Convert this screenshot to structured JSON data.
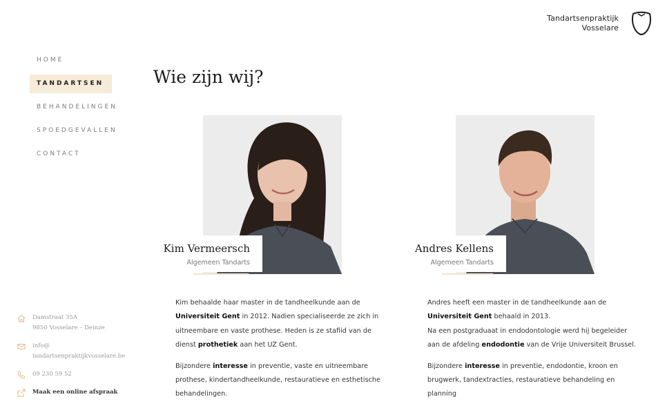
{
  "brand": {
    "line1": "Tandartsenpraktijk",
    "line2": "Vosselare",
    "logo": "tooth-icon"
  },
  "nav": {
    "items": [
      {
        "label": "HOME",
        "active": false
      },
      {
        "label": "TANDARTSEN",
        "active": true
      },
      {
        "label": "BEHANDELINGEN",
        "active": false
      },
      {
        "label": "SPOEDGEVALLEN",
        "active": false
      },
      {
        "label": "CONTACT",
        "active": false
      }
    ]
  },
  "contact": {
    "address_line1": "Damstraat 35A",
    "address_line2": "9850 Vosselare – Deinze",
    "email_line1": "info@",
    "email_line2": "tandartsenpraktijkvosselare.be",
    "phone": "09 230 59 52",
    "appointment": "Maak een online afspraak"
  },
  "page": {
    "title": "Wie zijn wij?"
  },
  "dentists": [
    {
      "name": "Kim Vermeersch",
      "role": "Algemeen Tandarts",
      "bio1": {
        "a": "Kim behaalde haar master in de tandheelkunde aan de ",
        "b1": "Universiteit Gent",
        "c": " in 2012. Nadien specialiseerde ze zich in uitneembare en vaste prothese. Heden is ze stafiid van de dienst ",
        "b2": "prothetiek",
        "d": " aan het UZ Gent."
      },
      "bio2": {
        "a": "Bijzondere ",
        "b": "interesse",
        "c": " in preventie, vaste en uitneembare prothese, kindertandheelkunde, restauratieve en esthetische behandelingen."
      }
    },
    {
      "name": "Andres Kellens",
      "role": "Algemeen Tandarts",
      "bio1": {
        "a": "Andres heeft een master in de tandheelkunde aan de ",
        "b1": "Universiteit Gent",
        "c": " behaald in 2013.",
        "line2a": "Na een postgraduaat in endodontologie werd hij begeleider aan de afdeling ",
        "b2": "endodontie",
        "d": " van de Vrije Universiteit Brussel."
      },
      "bio2": {
        "a": "Bijzondere ",
        "b": "interesse",
        "c": " in preventie, endodontie, kroon en brugwerk, tandextracties, restauratieve behandeling en planning"
      }
    }
  ],
  "colors": {
    "accent": "#f6ead8",
    "accent_line": "#f3e3cc",
    "icon": "#e2b98a",
    "scrub": "#4a4f57"
  }
}
